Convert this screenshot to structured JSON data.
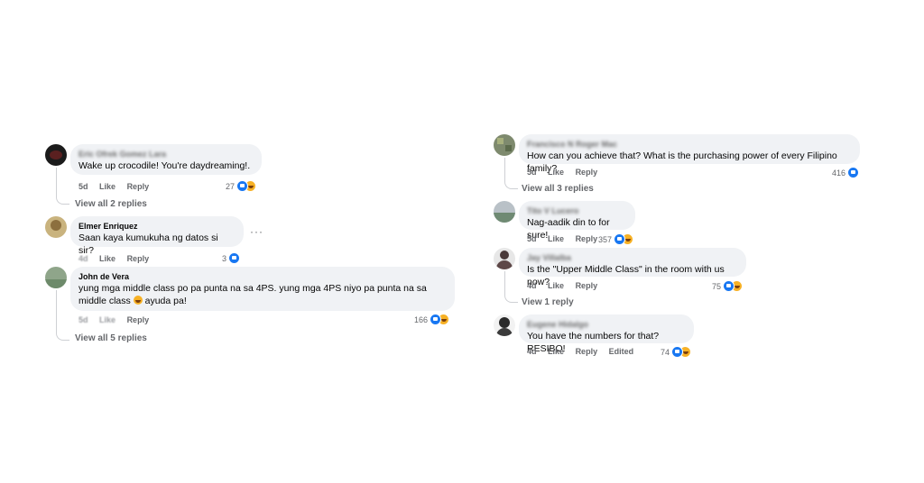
{
  "left_thread": {
    "comments": [
      {
        "author": "Eric Ofrek Gomez Lara",
        "text": "Wake up crocodile! You're daydreaming!.",
        "time": "5d",
        "like": "Like",
        "reply": "Reply",
        "reaction_count": "27",
        "view_replies": "View all 2 replies"
      },
      {
        "author": "Elmer Enriquez",
        "text": "Saan kaya kumukuha ng datos si sir?",
        "time": "4d",
        "like": "Like",
        "reply": "Reply",
        "reaction_count": "3",
        "more": "···"
      },
      {
        "author": "John de Vera",
        "text_line1": "yung mga middle class po pa punta na sa 4PS. yung mga 4PS niyo pa punta na sa",
        "text_line2a": "middle class",
        "text_line2b": "ayuda pa!",
        "time": "5d",
        "like": "Like",
        "reply": "Reply",
        "reaction_count": "166",
        "view_replies": "View all 5 replies"
      }
    ]
  },
  "right_thread": {
    "comments": [
      {
        "author": "Francisco N Roger Mac",
        "text": "How can you achieve that? What is the purchasing power of every Filipino family?",
        "time": "5d",
        "like": "Like",
        "reply": "Reply",
        "reaction_count": "416",
        "view_replies": "View all 3 replies"
      },
      {
        "author": "Tito V Lucero",
        "text": "Nag-aadik din to for sure!",
        "time": "5d",
        "like": "Like",
        "reply": "Reply",
        "reaction_count": "357"
      },
      {
        "author": "Jay Villalba",
        "text": "Is the \"Upper Middle Class\" in the room with us now?",
        "time": "4d",
        "like": "Like",
        "reply": "Reply",
        "reaction_count": "75",
        "view_replies": "View 1 reply"
      },
      {
        "author": "Eugene Hidalgo",
        "text": "You have the numbers for that? RESIBO!",
        "time": "4d",
        "like": "Like",
        "reply": "Reply",
        "edited": "Edited",
        "reaction_count": "74"
      }
    ]
  },
  "colors": {
    "bubble": "#f0f2f5",
    "secondary_text": "#65676b",
    "like_blue": "#1877f2",
    "haha_yellow": "#f7b125"
  }
}
